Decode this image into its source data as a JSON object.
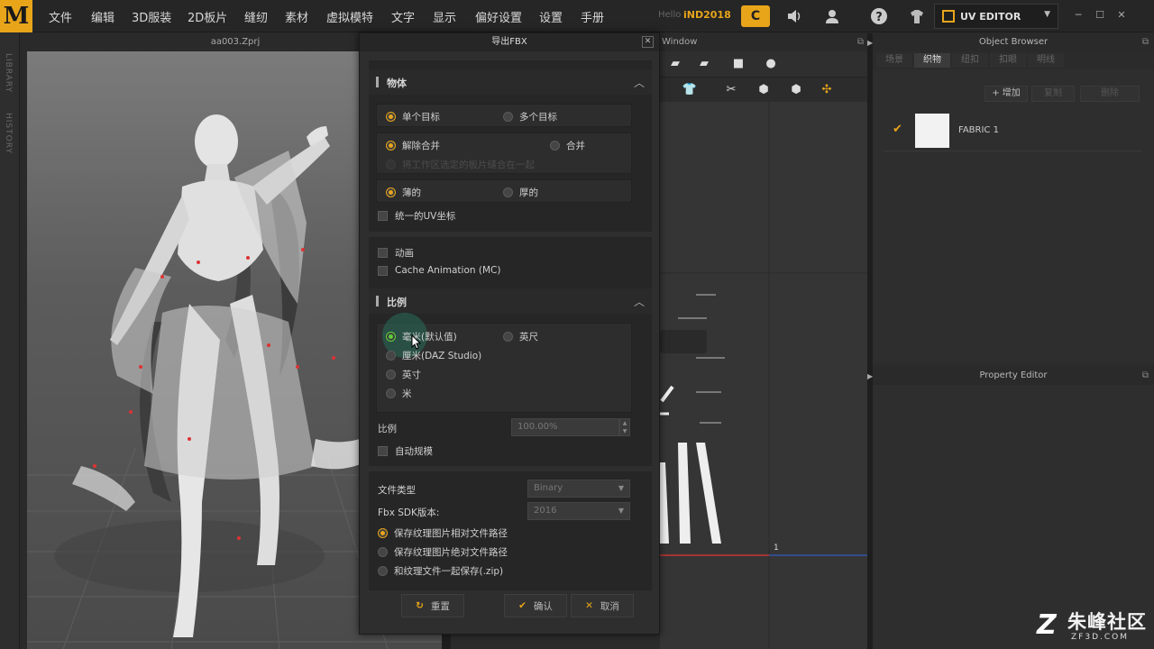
{
  "menubar": {
    "logo": "M",
    "items": [
      "文件",
      "编辑",
      "3D服装",
      "2D板片",
      "缝纫",
      "素材",
      "虚拟模特",
      "文字",
      "显示",
      "偏好设置",
      "设置",
      "手册"
    ],
    "hello": "Hello",
    "user": "iND2018",
    "workspace_label": "UV EDITOR"
  },
  "left_strip": {
    "tab1": "LIBRARY",
    "tab2": "HISTORY"
  },
  "viewport3d": {
    "title": "aa003.Zprj"
  },
  "window2d": {
    "title": "Window",
    "axis_label": "1"
  },
  "object_browser": {
    "title": "Object Browser",
    "tabs": [
      "场景",
      "织物",
      "纽扣",
      "扣眼",
      "明线"
    ],
    "active_tab": "织物",
    "buttons": {
      "add": "+ 增加",
      "copy": "复制",
      "delete": "删除"
    },
    "fabric_name": "FABRIC 1"
  },
  "property_editor": {
    "title": "Property Editor"
  },
  "dialog": {
    "title": "导出FBX",
    "object_section": {
      "title": "物体",
      "single_target": "单个目标",
      "multi_target": "多个目标",
      "unmerge": "解除合并",
      "merge": "合并",
      "merge_hint": "将工作区选定的板片缝合在一起",
      "thin": "薄的",
      "thick": "厚的",
      "unified_uv": "统一的UV坐标",
      "animation": "动画",
      "cache_animation": "Cache Animation (MC)"
    },
    "scale_section": {
      "title": "比例",
      "mm_default": "毫米(默认值)",
      "feet": "英尺",
      "cm_daz": "厘米(DAZ Studio)",
      "inch": "英寸",
      "meter": "米",
      "scale_label": "比例",
      "scale_value": "100.00%",
      "auto_scale": "自动规模"
    },
    "file_section": {
      "file_type_label": "文件类型",
      "file_type_value": "Binary",
      "sdk_label": "Fbx SDK版本:",
      "sdk_value": "2016",
      "save_relative": "保存纹理图片相对文件路径",
      "save_absolute": "保存纹理图片绝对文件路径",
      "save_zip": "和纹理文件一起保存(.zip)"
    },
    "buttons": {
      "reset": "重置",
      "ok": "确认",
      "cancel": "取消"
    }
  },
  "watermark": {
    "main": "朱峰社区",
    "sub": "ZF3D.COM"
  },
  "colors": {
    "accent": "#e8a51a",
    "selected_radio": "#5fcf3b",
    "background": "#2b2b2b"
  }
}
